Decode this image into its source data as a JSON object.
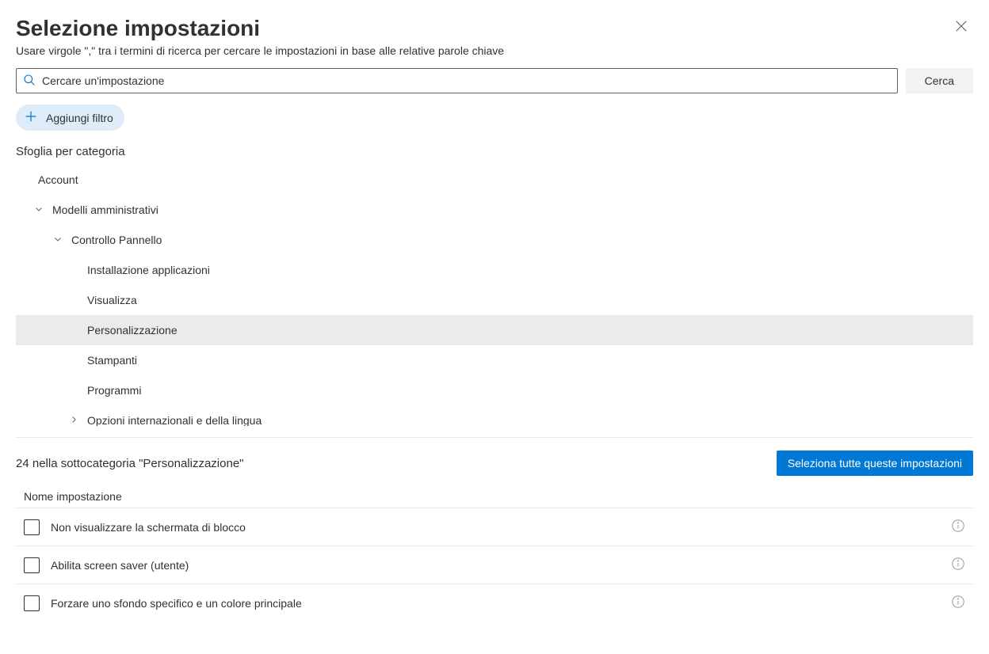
{
  "header": {
    "title": "Selezione impostazioni",
    "subtitle": "Usare virgole   \",\" tra i termini di ricerca per cercare le impostazioni in base alle relative parole chiave"
  },
  "search": {
    "placeholder": "Cercare un'impostazione",
    "button": "Cerca"
  },
  "filter": {
    "add": "Aggiungi filtro"
  },
  "browse": {
    "label": "Sfoglia per categoria"
  },
  "tree": {
    "account": "Account",
    "admin_templates": "Modelli amministrativi",
    "control_panel": "Controllo Pannello",
    "install_apps": "Installazione applicazioni",
    "display": "Visualizza",
    "personalization": "Personalizzazione",
    "printers": "Stampanti",
    "programs": "Programmi",
    "regional_lang": "Opzioni internazionali e della lingua"
  },
  "subcategory": {
    "count_text": "24 nella sottocategoria \"Personalizzazione\"",
    "select_all": "Seleziona tutte queste impostazioni",
    "column_header": "Nome impostazione"
  },
  "settings": [
    {
      "label": "Non visualizzare la schermata di blocco"
    },
    {
      "label": "Abilita screen saver (utente)"
    },
    {
      "label": "Forzare uno sfondo specifico e un colore principale"
    }
  ]
}
